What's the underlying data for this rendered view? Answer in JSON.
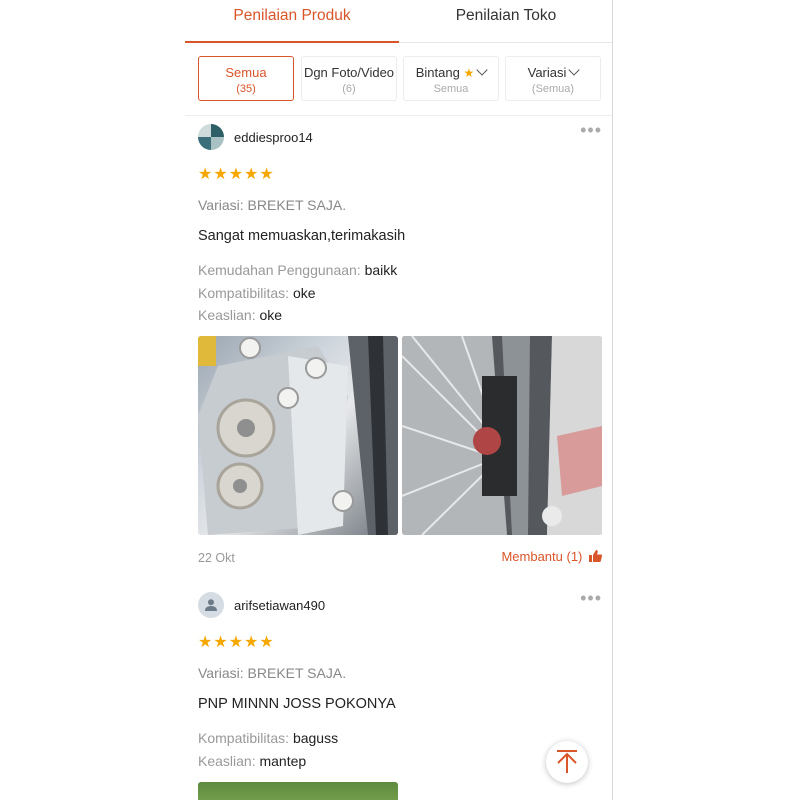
{
  "tabs": [
    {
      "label": "Penilaian Produk",
      "active": true
    },
    {
      "label": "Penilaian Toko",
      "active": false
    }
  ],
  "filters": [
    {
      "label": "Semua",
      "sub": "(35)",
      "active": true
    },
    {
      "label": "Dgn Foto/Video",
      "sub": "(6)",
      "active": false
    },
    {
      "label": "Bintang",
      "sub": "Semua",
      "active": false,
      "icon": "star-icon"
    },
    {
      "label": "Variasi",
      "sub": "(Semua)",
      "active": false,
      "icon": "chevron-down-icon"
    }
  ],
  "reviews": [
    {
      "username": "eddiesproo14",
      "stars": "★★★★★",
      "variasi": "Variasi: BREKET SAJA.",
      "comment": "Sangat memuaskan,terimakasih",
      "attributes": [
        {
          "key": "Kemudahan Penggunaan:",
          "value": "baikk"
        },
        {
          "key": "Kompatibilitas:",
          "value": "oke"
        },
        {
          "key": "Keaslian:",
          "value": "oke"
        }
      ],
      "date": "22 Okt",
      "helpful": "Membantu (1)"
    },
    {
      "username": "arifsetiawan490",
      "stars": "★★★★★",
      "variasi": "Variasi: BREKET SAJA.",
      "comment": "PNP MINNN JOSS POKONYA",
      "attributes": [
        {
          "key": "Kompatibilitas:",
          "value": "baguss"
        },
        {
          "key": "Keaslian:",
          "value": "mantep"
        }
      ]
    }
  ],
  "more_glyph": "•••",
  "accent_color": "#d9552a",
  "star_color": "#f6a700"
}
